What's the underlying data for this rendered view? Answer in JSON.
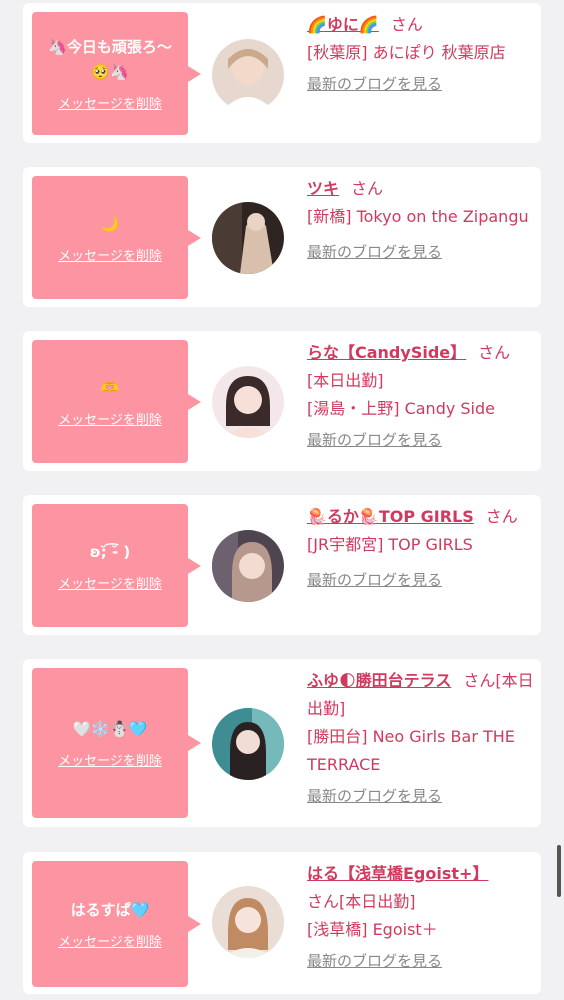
{
  "items": [
    {
      "message": "🦄今日も頑張ろ〜🥺🦄",
      "delete_label": "メッセージを削除",
      "name": "🌈ゆに🌈",
      "san": "さん",
      "shop": "[秋葉原] あにぽり 秋葉原店",
      "extra": "",
      "blog_link": "最新のブログを見る",
      "avatar_colors": [
        "#d9c6b8",
        "#f1d9c9"
      ]
    },
    {
      "message": "🌙",
      "delete_label": "メッセージを削除",
      "name": "ツキ",
      "san": "さん",
      "shop": "[新橋] Tokyo on the Zipangu",
      "extra": "",
      "blog_link": "最新のブログを見る",
      "avatar_colors": [
        "#3b302c",
        "#d9c0ad"
      ]
    },
    {
      "message": "🫶",
      "delete_label": "メッセージを削除",
      "name": "らな【CandySide】",
      "san": "さん",
      "shop": "[本日出勤]",
      "extra": "[湯島・上野] Candy Side",
      "blog_link": "最新のブログを見る",
      "avatar_colors": [
        "#f4e6ea",
        "#e8cfd5"
      ]
    },
    {
      "message": "ʚ;̆ ͡-̆ )",
      "delete_label": "メッセージを削除",
      "name": "🪼るか🪼TOP GIRLS",
      "san": "さん",
      "shop": "[JR宇都宮] TOP GIRLS",
      "extra": "",
      "blog_link": "最新のブログを見る",
      "avatar_colors": [
        "#5b4a55",
        "#c9a9b4"
      ]
    },
    {
      "message": "🤍❄️☃️🩵",
      "delete_label": "メッセージを削除",
      "name": "ふゆ🌓勝田台テラス",
      "san": "さん",
      "shop": "[本日出勤]",
      "extra": "[勝田台] Neo Girls Bar THE TERRACE",
      "blog_link": "最新のブログを見る",
      "avatar_colors": [
        "#3f8f95",
        "#9dd0cf"
      ]
    },
    {
      "message": "はるすぱ🩵",
      "delete_label": "メッセージを削除",
      "name": "はる【浅草橋Egoist+】",
      "san": "さん",
      "shop": "[本日出勤]",
      "extra": "[浅草橋] Egoist＋",
      "blog_link": "最新のブログを見る",
      "avatar_colors": [
        "#e7d8d0",
        "#f2e6de"
      ]
    }
  ]
}
